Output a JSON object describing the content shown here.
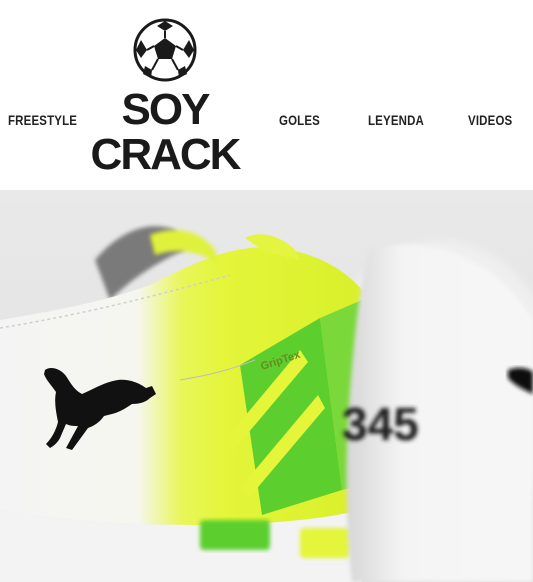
{
  "brand": {
    "line1": "SOY",
    "line2": "CRACK",
    "logo_icon": "soccer-ball-icon"
  },
  "nav": {
    "items": [
      {
        "label": "FREESTYLE"
      },
      {
        "label": "GOLES"
      },
      {
        "label": "LEYENDA"
      },
      {
        "label": "VIDEOS"
      }
    ]
  },
  "hero": {
    "image_subject": "puma-football-boots-photo",
    "boot_text": "GripTex",
    "heel_number": "345",
    "colors": {
      "boot_white": "#f2f2f2",
      "neon_yellow": "#e4f53a",
      "green": "#5ccf2e",
      "background": "#e7e7e7"
    }
  }
}
